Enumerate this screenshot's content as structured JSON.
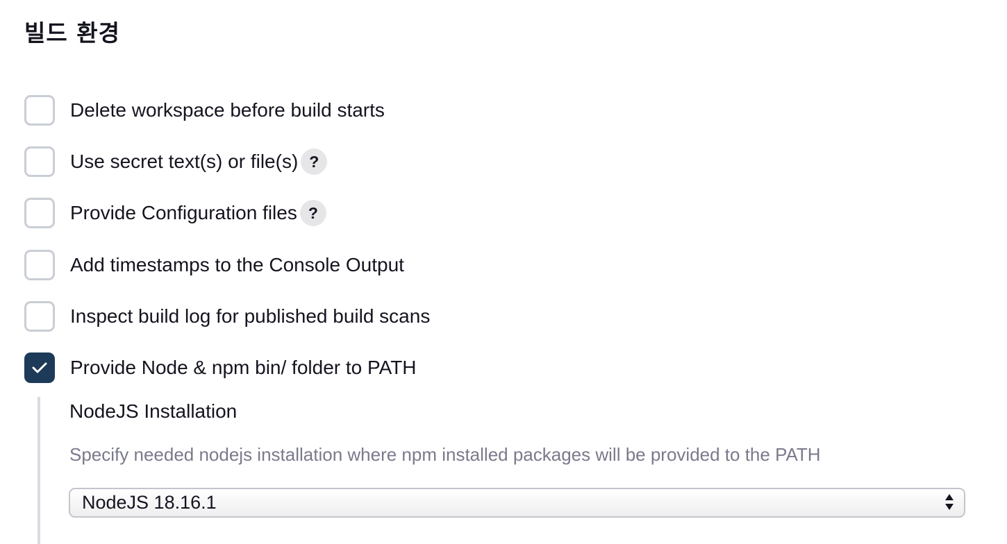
{
  "section": {
    "title": "빌드 환경"
  },
  "options": [
    {
      "label": "Delete workspace before build starts",
      "checked": false,
      "help": false
    },
    {
      "label": "Use secret text(s) or file(s)",
      "checked": false,
      "help": true
    },
    {
      "label": "Provide Configuration files",
      "checked": false,
      "help": true
    },
    {
      "label": "Add timestamps to the Console Output",
      "checked": false,
      "help": false
    },
    {
      "label": "Inspect build log for published build scans",
      "checked": false,
      "help": false
    },
    {
      "label": "Provide Node & npm bin/ folder to PATH",
      "checked": true,
      "help": false
    }
  ],
  "help_icon_text": "?",
  "nodejs": {
    "title": "NodeJS Installation",
    "description": "Specify needed nodejs installation where npm installed packages will be provided to the PATH",
    "selected": "NodeJS 18.16.1"
  },
  "colors": {
    "checked_bg": "#1d3a58",
    "unchecked_border": "#c9cdd4",
    "description_text": "#7a7a8c"
  }
}
